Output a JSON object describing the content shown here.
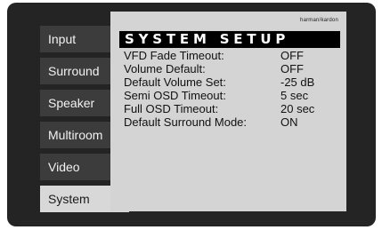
{
  "menu": {
    "items": [
      {
        "label": "Input",
        "active": false
      },
      {
        "label": "Surround",
        "active": false
      },
      {
        "label": "Speaker",
        "active": false
      },
      {
        "label": "Multiroom",
        "active": false
      },
      {
        "label": "Video",
        "active": false
      },
      {
        "label": "System",
        "active": true
      }
    ]
  },
  "panel": {
    "brand": "harman/kardon",
    "title": "SYSTEM SETUP",
    "settings": [
      {
        "label": "VFD Fade Timeout:",
        "value": "OFF"
      },
      {
        "label": "Volume Default:",
        "value": "OFF"
      },
      {
        "label": "Default Volume Set:",
        "value": "-25 dB"
      },
      {
        "label": "Semi OSD Timeout:",
        "value": "5 sec"
      },
      {
        "label": "Full OSD Timeout:",
        "value": "20 sec"
      },
      {
        "label": "Default Surround Mode:",
        "value": "ON"
      }
    ]
  },
  "colors": {
    "background": "#242424",
    "tab": "#3c3c3c",
    "active_tab": "#d8d8d8",
    "panel": "#d4d4d4",
    "title_bar": "#000000"
  }
}
